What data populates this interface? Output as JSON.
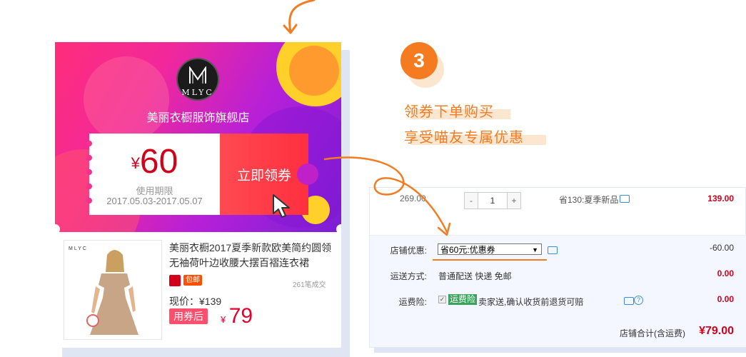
{
  "store": {
    "logo_text": "MLYC",
    "logo_subtext": "美丽衣橱",
    "name": "美丽衣橱服饰旗舰店"
  },
  "coupon": {
    "currency": "¥",
    "amount": "60",
    "validity_label": "使用期限",
    "validity": "2017.05.03-2017.05.07",
    "claim_label": "立即领券"
  },
  "product": {
    "image_logo": "MLYC",
    "title": "美丽衣橱2017夏季新款欧美简约圆领无袖荷叶边收腰大摆百褶连衣裙",
    "platform_badge": "包邮",
    "sales": "261笔成交",
    "current_price": "现价：¥139",
    "use_coupon_label": "用券后",
    "final_currency": "¥",
    "final_price": "79"
  },
  "step": {
    "number": "3",
    "line1": "领券下单购买",
    "line2": "享受喵友专属优惠"
  },
  "cart": {
    "item": {
      "unit_price": "269.00",
      "quantity": "1",
      "minus": "-",
      "plus": "+",
      "promo": "省130:夏季新品",
      "subtotal": "139.00"
    },
    "store_discount": {
      "label": "店铺优惠:",
      "selected": "省60元:优惠券",
      "amount": "-60.00"
    },
    "shipping": {
      "label": "运送方式:",
      "value": "普通配送 快递 免邮",
      "amount": "0.00"
    },
    "insurance": {
      "label": "运费险:",
      "badge": "运费险",
      "value": "卖家送,确认收货前退货可赔",
      "amount": "0.00"
    },
    "total": {
      "label": "店铺合计(含运费)",
      "value": "¥79.00"
    }
  },
  "colors": {
    "accent": "#f47b20",
    "price_red": "#d0021b",
    "coupon_red": "#ff3f45"
  }
}
